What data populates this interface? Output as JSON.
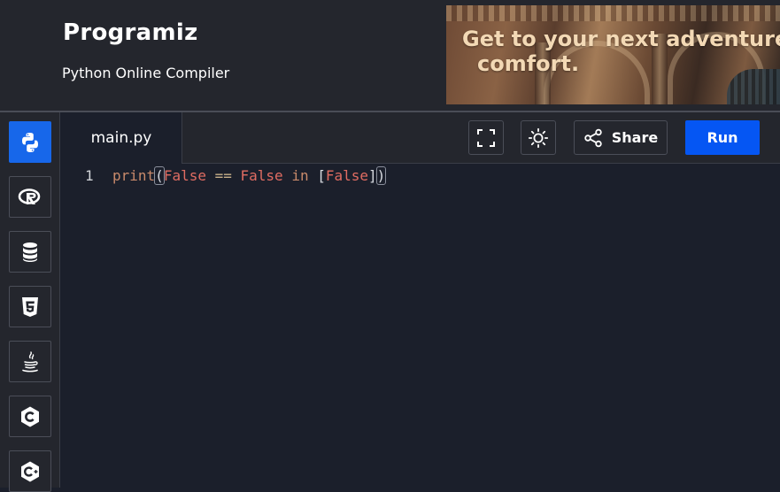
{
  "header": {
    "logo": "Programiz",
    "subtitle": "Python Online Compiler",
    "ad": {
      "line1": "Get to your next adventure",
      "line2": "comfort."
    }
  },
  "sidebar": {
    "items": [
      {
        "name": "python",
        "icon": "python-icon",
        "active": true
      },
      {
        "name": "r",
        "icon": "r-icon",
        "active": false
      },
      {
        "name": "sql",
        "icon": "database-icon",
        "active": false
      },
      {
        "name": "html",
        "icon": "html5-icon",
        "active": false
      },
      {
        "name": "java",
        "icon": "java-icon",
        "active": false
      },
      {
        "name": "c",
        "icon": "c-icon",
        "active": false
      },
      {
        "name": "cpp",
        "icon": "cpp-icon",
        "active": false
      }
    ]
  },
  "toolbar": {
    "file_tab": "main.py",
    "fullscreen_icon": "fullscreen-icon",
    "theme_icon": "sun-icon",
    "share_label": "Share",
    "share_icon": "share-icon",
    "run_label": "Run"
  },
  "editor": {
    "lines": [
      {
        "number": "1",
        "tokens": {
          "fn": "print",
          "open_paren": "(",
          "kw1": "False",
          "op1": " == ",
          "kw2": "False",
          "op2": " in ",
          "open_br": "[",
          "kw3": "False",
          "close_br": "]",
          "close_paren": ")"
        }
      }
    ]
  },
  "colors": {
    "accent": "#1767ea",
    "run": "#0556f3",
    "background": "#1b1f2b",
    "panel": "#24262d"
  }
}
